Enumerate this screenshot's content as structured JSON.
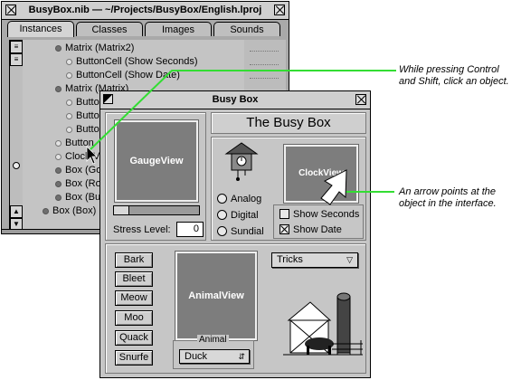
{
  "nib_window": {
    "title": "BusyBox.nib — ~/Projects/BusyBox/English.lproj",
    "tabs": [
      "Instances",
      "Classes",
      "Images",
      "Sounds"
    ],
    "outline_items": [
      "Matrix (Matrix2)",
      "ButtonCell (Show Seconds)",
      "ButtonCell (Show Date)",
      "Matrix (Matrix)",
      "Butto",
      "Butto",
      "Butto",
      "Button",
      "Clock(V",
      "Box (Go",
      "Box (Ro",
      "Box (Bu",
      "Box (Box)"
    ]
  },
  "busy_window": {
    "title": "Busy Box",
    "heading": "The Busy Box",
    "gauge_label": "GaugeView",
    "stress_label": "Stress Level:",
    "stress_value": "0",
    "clock_label": "ClockView",
    "radios": [
      "Analog",
      "Digital",
      "Sundial"
    ],
    "checks": [
      "Show Seconds",
      "Show Date"
    ],
    "animal_buttons": [
      "Bark",
      "Bleet",
      "Meow",
      "Moo",
      "Quack",
      "Snurfe"
    ],
    "animal_view_label": "AnimalView",
    "animal_group_label": "Animal",
    "animal_popup": "Duck",
    "tricks_popup": "Tricks"
  },
  "annotations": {
    "top": "While pressing Control and Shift, click an object.",
    "top_line1": "While pressing Control",
    "top_line2": "and Shift, click an object.",
    "bottom_line1": "An arrow points at the",
    "bottom_line2": "object in the interface."
  },
  "colors": {
    "annotation_line": "#33dd33",
    "view_fill": "#7d7d7d"
  }
}
